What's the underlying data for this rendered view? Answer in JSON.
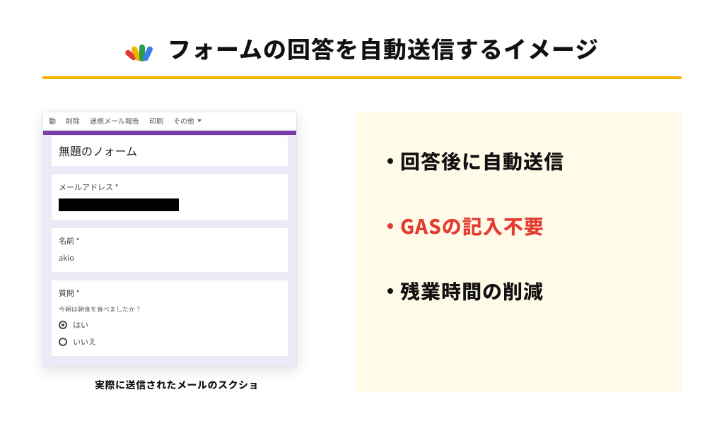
{
  "title": "フォームの回答を自動送信するイメージ",
  "email_toolbar": {
    "move": "動",
    "delete": "削除",
    "spam": "迷惑メール報告",
    "print": "印刷",
    "others": "その他"
  },
  "form": {
    "title": "無題のノォーム",
    "email_label": "メールアドレス *",
    "name_label": "名前 *",
    "name_value": "akio",
    "question_label": "質問 *",
    "question_sub": "今朝は朝食を食べましたか？",
    "opt_yes": "はい",
    "opt_no": "いいえ"
  },
  "caption": "実際に送信されたメールのスクショ",
  "benefits": [
    {
      "text": "回答後に自動送信",
      "highlight": false
    },
    {
      "text": "GASの記入不要",
      "highlight": true
    },
    {
      "text": "残業時間の削減",
      "highlight": false
    }
  ]
}
